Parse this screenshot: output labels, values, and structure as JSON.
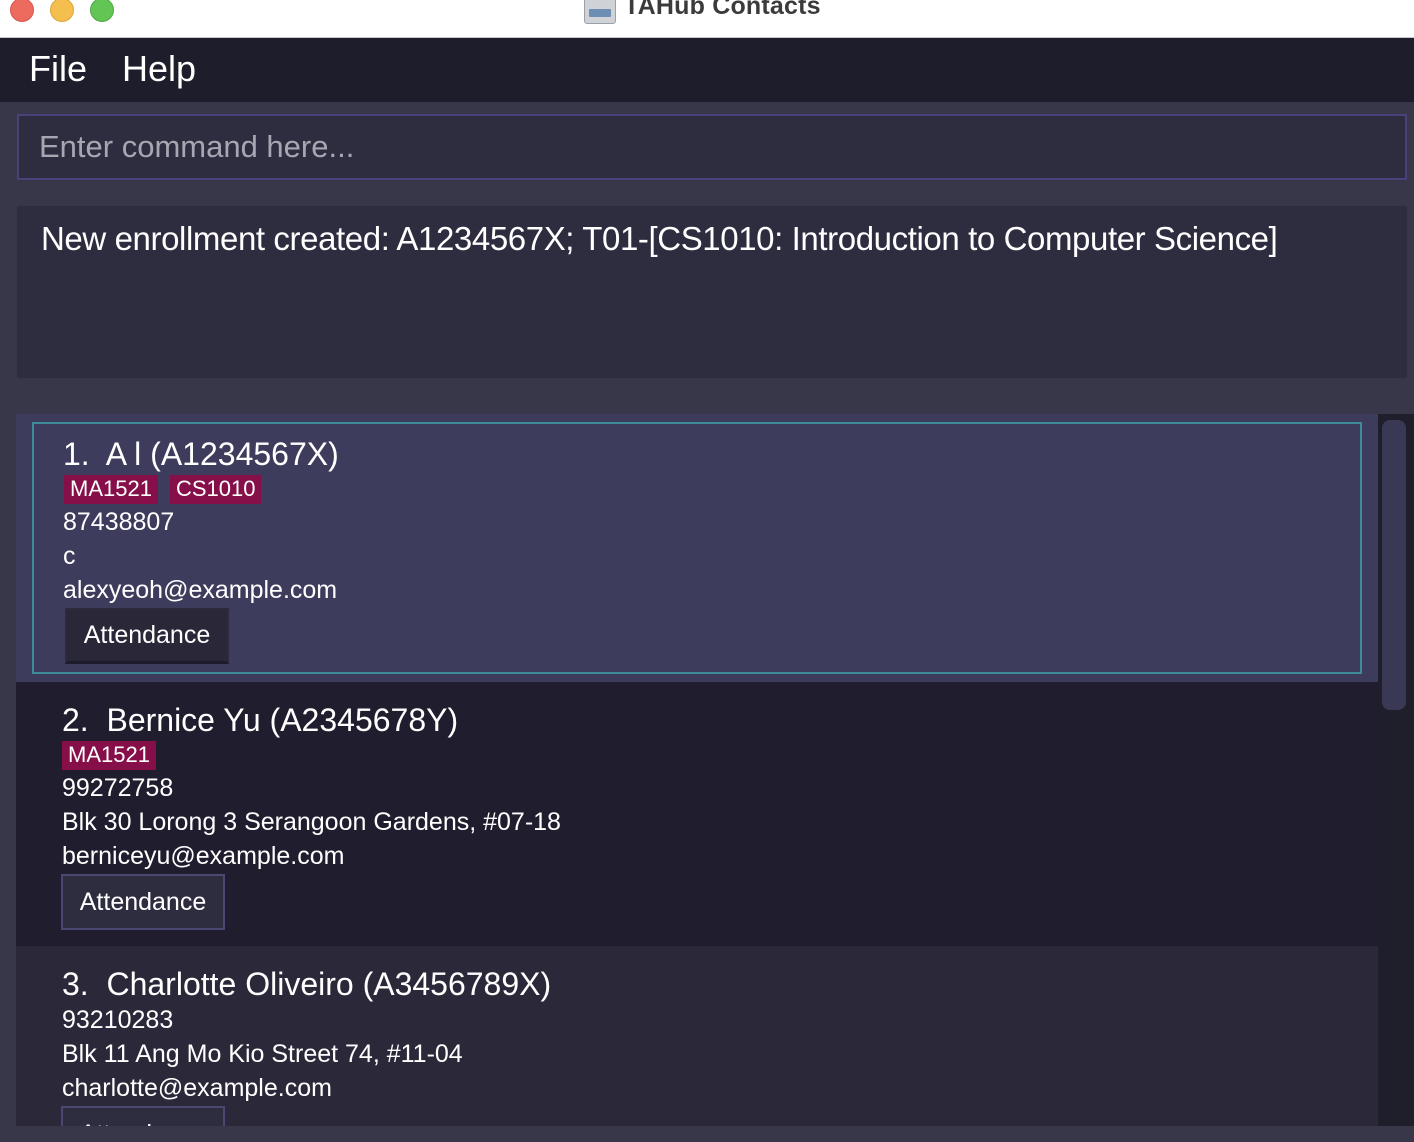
{
  "window": {
    "title": "TAHub Contacts",
    "app_icon": "tahub-app-icon"
  },
  "menu": {
    "file": "File",
    "help": "Help"
  },
  "command": {
    "placeholder": "Enter command here...",
    "value": ""
  },
  "result": {
    "message": "New enrollment created: A1234567X; T01-[CS1010: Introduction to Computer Science]"
  },
  "persons": [
    {
      "index": "1.",
      "name": "A l (A1234567X)",
      "tags": [
        "MA1521",
        "CS1010"
      ],
      "phone": "87438807",
      "address": "c",
      "email": "alexyeoh@example.com",
      "button": "Attendance",
      "selected": true
    },
    {
      "index": "2.",
      "name": "Bernice Yu (A2345678Y)",
      "tags": [
        "MA1521"
      ],
      "phone": "99272758",
      "address": "Blk 30 Lorong 3 Serangoon Gardens, #07-18",
      "email": "berniceyu@example.com",
      "button": "Attendance",
      "selected": false
    },
    {
      "index": "3.",
      "name": "Charlotte Oliveiro (A3456789X)",
      "tags": [],
      "phone": "93210283",
      "address": "Blk 11 Ang Mo Kio Street 74, #11-04",
      "email": "charlotte@example.com",
      "button": "Attendance",
      "selected": false
    }
  ],
  "colors": {
    "background": "#282637",
    "menu_bar": "#1d1d2b",
    "panel": "#2e2c3f",
    "selected_card": "#3e3c5d",
    "selection_border": "#3d8a98",
    "tag": "#870f49"
  }
}
